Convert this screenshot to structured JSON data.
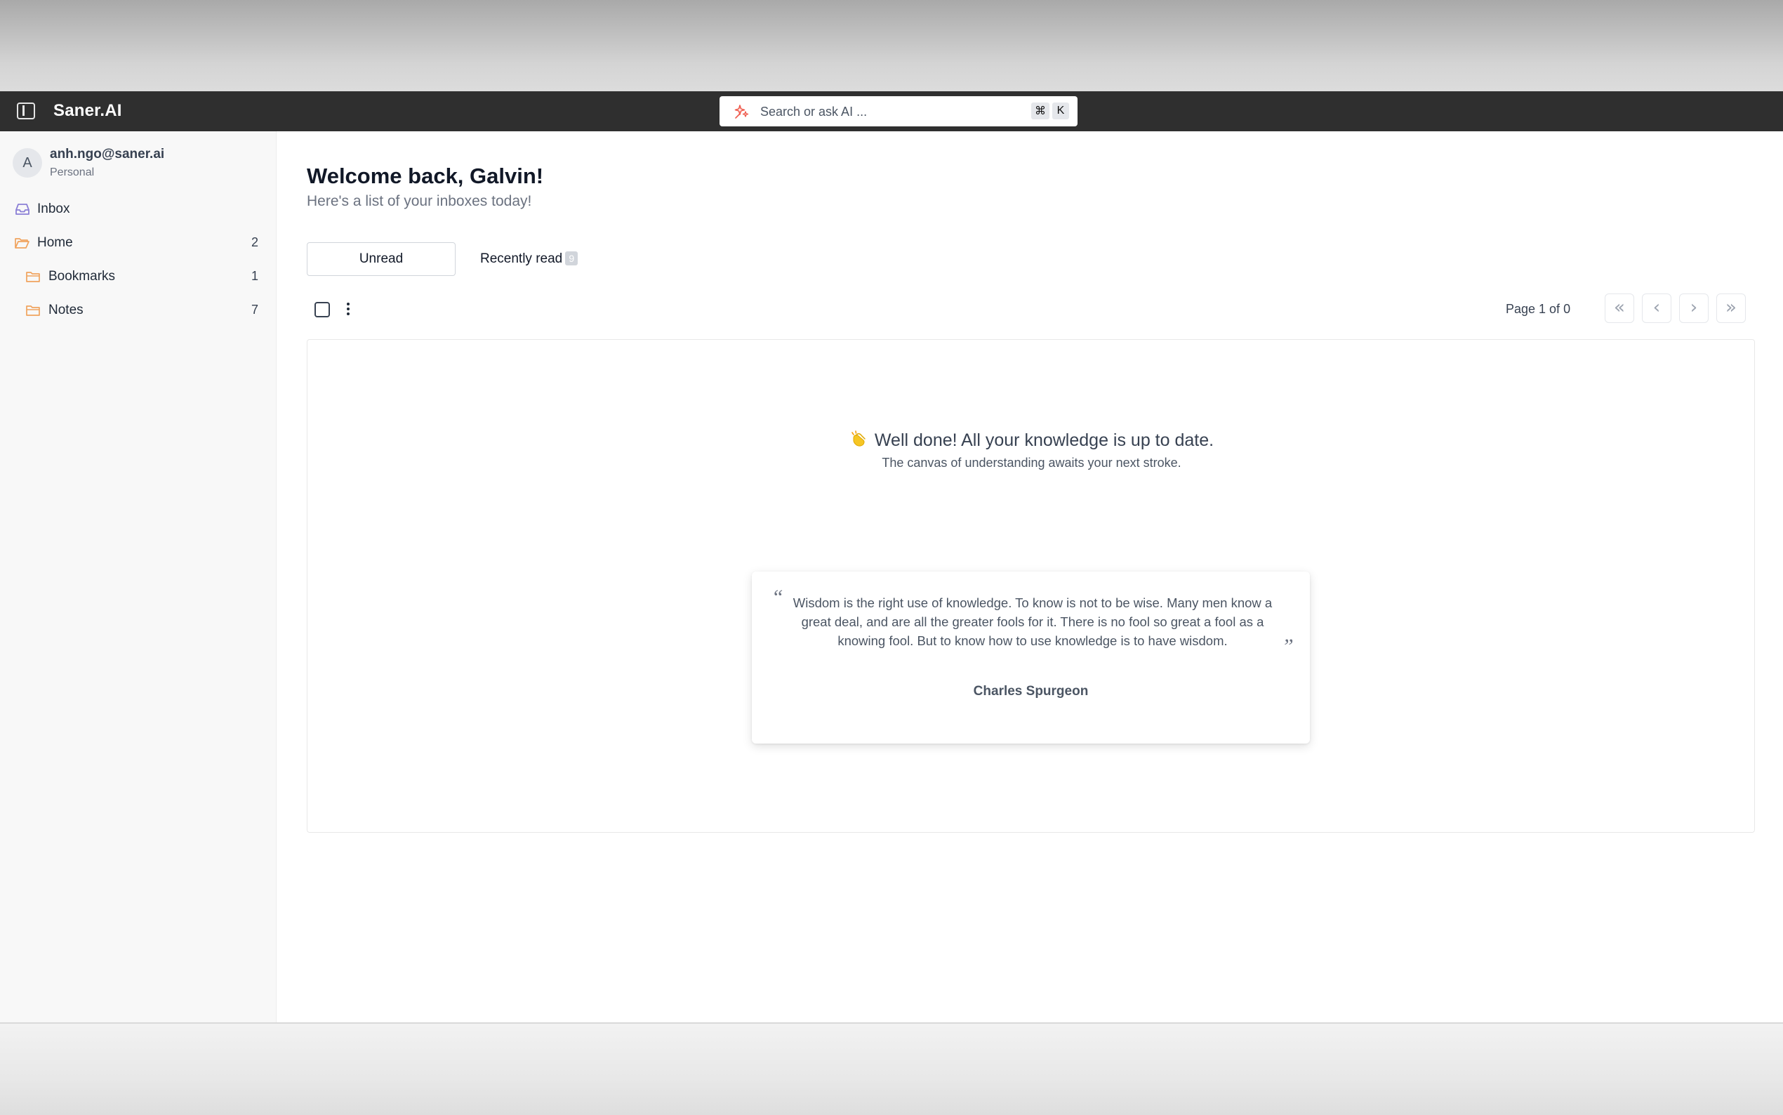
{
  "header": {
    "brand": "Saner.AI",
    "search_placeholder": "Search or ask AI ...",
    "shortcut_cmd": "⌘",
    "shortcut_key": "K"
  },
  "sidebar": {
    "account": {
      "avatar_letter": "A",
      "email": "anh.ngo@saner.ai",
      "type": "Personal"
    },
    "items": [
      {
        "label": "Inbox",
        "count": "",
        "icon": "inbox-icon"
      },
      {
        "label": "Home",
        "count": "2",
        "icon": "folder-icon"
      },
      {
        "label": "Bookmarks",
        "count": "1",
        "icon": "folder-icon"
      },
      {
        "label": "Notes",
        "count": "7",
        "icon": "folder-icon"
      }
    ]
  },
  "main": {
    "title": "Welcome back, Galvin!",
    "subtitle": "Here's a list of your inboxes today!",
    "tabs": [
      {
        "label": "Unread"
      },
      {
        "label": "Recently read",
        "badge": "9"
      }
    ],
    "pagination": {
      "label": "Page 1 of 0",
      "first": "«",
      "prev": "‹",
      "next": "›",
      "last": "»"
    },
    "empty_state": {
      "icon": "clapping-hands-icon",
      "headline": "Well done! All your knowledge is up to date.",
      "subline": "The canvas of understanding awaits your next stroke."
    },
    "quote": {
      "open_mark": "“",
      "close_mark": "”",
      "text": "Wisdom is the right use of knowledge. To know is not to be wise. Many men know a great deal, and are all the greater fools for it. There is no fool so great a fool as a knowing fool. But to know how to use knowledge is to have wisdom.",
      "author": "Charles Spurgeon"
    }
  },
  "colors": {
    "header_bg": "#2f2f2f",
    "sidebar_bg": "#f8f8f8",
    "folder_icon": "#f0a35e",
    "inbox_icon": "#8b7fd6",
    "ai_icon": "#ef5a4c"
  }
}
